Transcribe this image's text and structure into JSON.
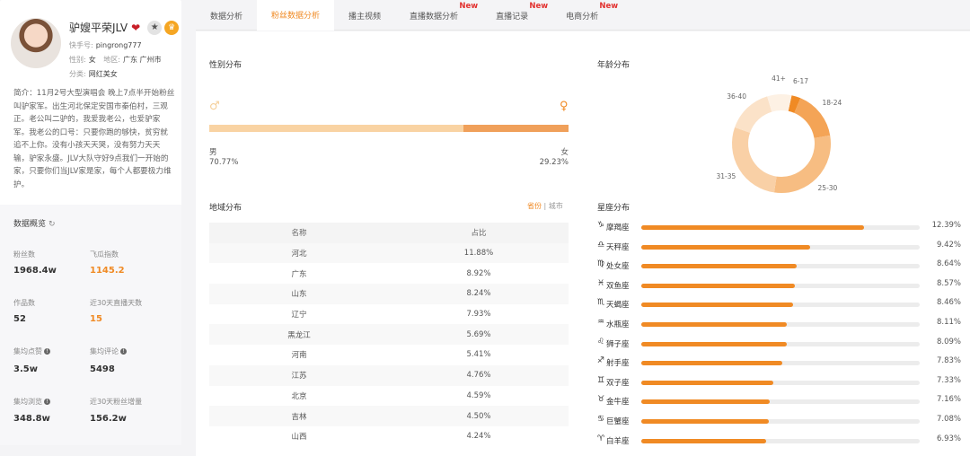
{
  "profile": {
    "name": "驴嫂平荣JLV",
    "account_label": "快手号:",
    "account_value": "pingrong777",
    "gender_label": "性别:",
    "gender_value": "女",
    "region_label": "地区:",
    "region_value": "广东 广州市",
    "category_label": "分类:",
    "category_value": "网红美女",
    "bio": "简介：11月2号大型演唱会 晚上7点半开始粉丝叫驴家军。出生河北保定安国市秦伯村，三观正。老公叫二驴的，我爱我老公，也爱驴家军。我老公的口号：只要你跑的够快，贫穷就追不上你。没有小孩天天哭，没有努力天天输，驴家永盛。JLV大队守好9点我们一开始的家，只要你们当JLV家是家，每个人都要极力维护。"
  },
  "overview": {
    "title": "数据概览",
    "stats": [
      {
        "label": "粉丝数",
        "value": "1968.4w",
        "info": false,
        "orange": false
      },
      {
        "label": "飞瓜指数",
        "value": "1145.2",
        "info": false,
        "orange": true
      },
      {
        "label": "作品数",
        "value": "52",
        "info": false,
        "orange": false
      },
      {
        "label": "近30天直播天数",
        "value": "15",
        "info": false,
        "orange": true
      },
      {
        "label": "集均点赞",
        "value": "3.5w",
        "info": true,
        "orange": false
      },
      {
        "label": "集均评论",
        "value": "5498",
        "info": true,
        "orange": false
      },
      {
        "label": "集均浏览",
        "value": "348.8w",
        "info": true,
        "orange": false
      },
      {
        "label": "近30天粉丝增量",
        "value": "156.2w",
        "info": false,
        "orange": false
      }
    ]
  },
  "tabs": [
    {
      "label": "数据分析",
      "active": false,
      "new": false
    },
    {
      "label": "粉丝数据分析",
      "active": true,
      "new": false
    },
    {
      "label": "播主视频",
      "active": false,
      "new": false
    },
    {
      "label": "直播数据分析",
      "active": false,
      "new": true
    },
    {
      "label": "直播记录",
      "active": false,
      "new": true
    },
    {
      "label": "电商分析",
      "active": false,
      "new": true
    }
  ],
  "new_badge": "New",
  "gender": {
    "title": "性别分布",
    "male_label": "男",
    "male_pct": "70.77%",
    "female_label": "女",
    "female_pct": "29.23%",
    "male_fraction": 0.7077,
    "colors": {
      "male": "#f9d3a3",
      "female": "#f0a05a"
    }
  },
  "region": {
    "title": "地域分布",
    "toggle_province": "省份",
    "toggle_sep": "|",
    "toggle_city": "城市",
    "headers": [
      "名称",
      "占比"
    ],
    "rows": [
      [
        "河北",
        "11.88%"
      ],
      [
        "广东",
        "8.92%"
      ],
      [
        "山东",
        "8.24%"
      ],
      [
        "辽宁",
        "7.93%"
      ],
      [
        "黑龙江",
        "5.69%"
      ],
      [
        "河南",
        "5.41%"
      ],
      [
        "江苏",
        "4.76%"
      ],
      [
        "北京",
        "4.59%"
      ],
      [
        "吉林",
        "4.50%"
      ],
      [
        "山西",
        "4.24%"
      ]
    ]
  },
  "age": {
    "title": "年龄分布",
    "segments": [
      {
        "label": "6-17",
        "value": 3,
        "color": "#f08a24"
      },
      {
        "label": "18-24",
        "value": 16,
        "color": "#f4a456"
      },
      {
        "label": "25-30",
        "value": 30,
        "color": "#f7bd82"
      },
      {
        "label": "31-35",
        "value": 28,
        "color": "#f9d0a6"
      },
      {
        "label": "36-40",
        "value": 15,
        "color": "#fbe2c8"
      },
      {
        "label": "41+",
        "value": 8,
        "color": "#fdf1e4"
      }
    ]
  },
  "zodiac": {
    "title": "星座分布",
    "items": [
      {
        "icon": "♑",
        "icon_name": "capricorn-icon",
        "name": "摩羯座",
        "pct": "12.39%",
        "value": 12.39
      },
      {
        "icon": "♎",
        "icon_name": "libra-icon",
        "name": "天秤座",
        "pct": "9.42%",
        "value": 9.42
      },
      {
        "icon": "♍",
        "icon_name": "virgo-icon",
        "name": "处女座",
        "pct": "8.64%",
        "value": 8.64
      },
      {
        "icon": "♓",
        "icon_name": "pisces-icon",
        "name": "双鱼座",
        "pct": "8.57%",
        "value": 8.57
      },
      {
        "icon": "♏",
        "icon_name": "scorpio-icon",
        "name": "天蝎座",
        "pct": "8.46%",
        "value": 8.46
      },
      {
        "icon": "♒",
        "icon_name": "aquarius-icon",
        "name": "水瓶座",
        "pct": "8.11%",
        "value": 8.11
      },
      {
        "icon": "♌",
        "icon_name": "leo-icon",
        "name": "狮子座",
        "pct": "8.09%",
        "value": 8.09
      },
      {
        "icon": "♐",
        "icon_name": "sagittarius-icon",
        "name": "射手座",
        "pct": "7.83%",
        "value": 7.83
      },
      {
        "icon": "♊",
        "icon_name": "gemini-icon",
        "name": "双子座",
        "pct": "7.33%",
        "value": 7.33
      },
      {
        "icon": "♉",
        "icon_name": "taurus-icon",
        "name": "金牛座",
        "pct": "7.16%",
        "value": 7.16
      },
      {
        "icon": "♋",
        "icon_name": "cancer-icon",
        "name": "巨蟹座",
        "pct": "7.08%",
        "value": 7.08
      },
      {
        "icon": "♈",
        "icon_name": "aries-icon",
        "name": "白羊座",
        "pct": "6.93%",
        "value": 6.93
      }
    ],
    "scale_max": 15.5
  },
  "accent_color": "#f08a24"
}
